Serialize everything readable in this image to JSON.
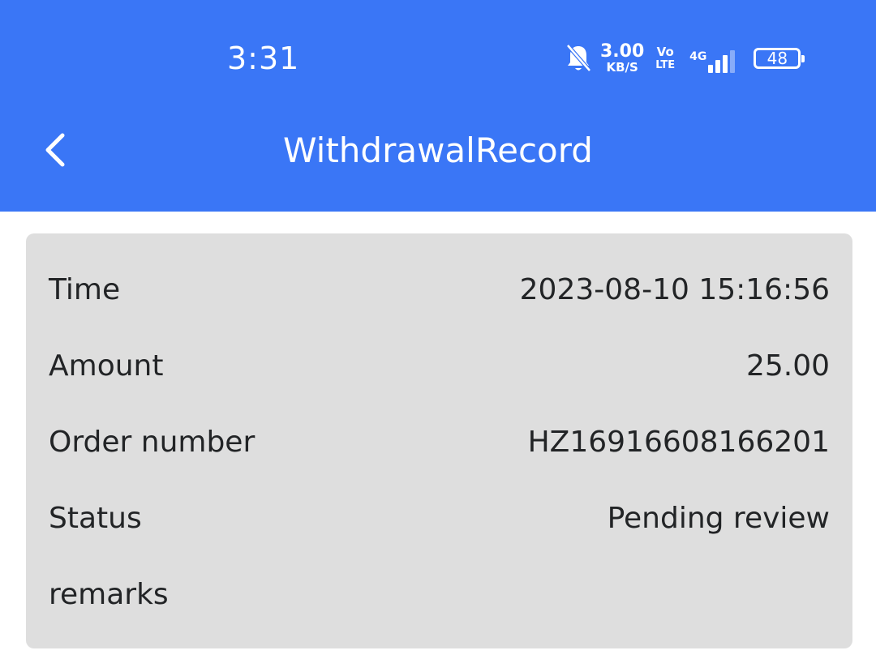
{
  "status_bar": {
    "time": "3:31",
    "speed_value": "3.00",
    "speed_unit": "KB/S",
    "volte_top": "Vo",
    "volte_bottom": "LTE",
    "network": "4G",
    "battery": "48",
    "icons": [
      "bell-muted-icon",
      "signal-icon",
      "battery-icon"
    ]
  },
  "header": {
    "title": "WithdrawalRecord",
    "back_icon": "chevron-left-icon",
    "background": "#3a76f6"
  },
  "record": {
    "rows": [
      {
        "label": "Time",
        "value": "2023-08-10 15:16:56"
      },
      {
        "label": "Amount",
        "value": "25.00"
      },
      {
        "label": "Order number",
        "value": "HZ16916608166201"
      },
      {
        "label": "Status",
        "value": "Pending review"
      },
      {
        "label": "remarks",
        "value": ""
      }
    ],
    "card_background": "#dedede"
  }
}
